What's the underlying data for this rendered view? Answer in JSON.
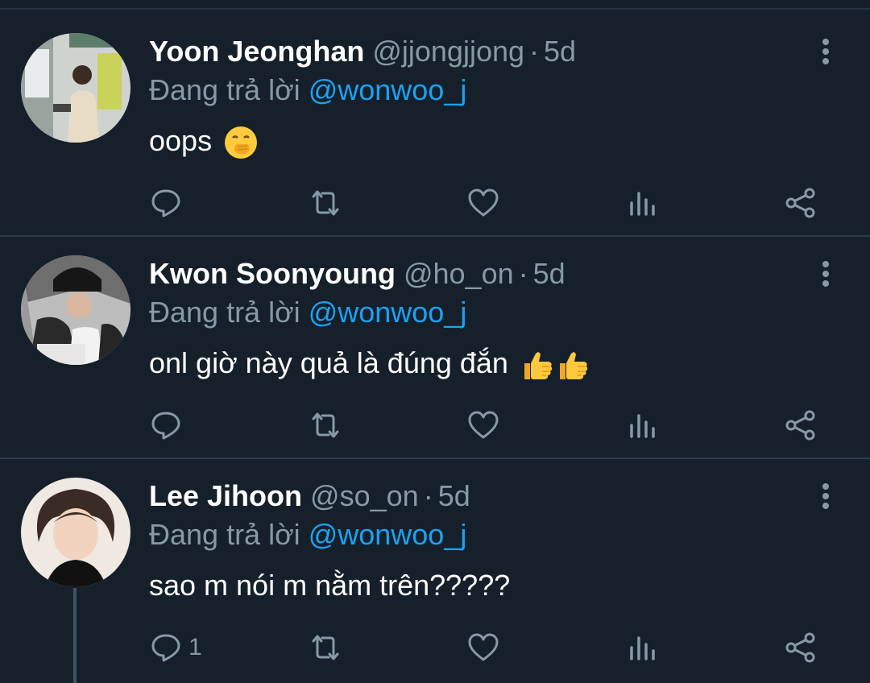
{
  "colors": {
    "background": "#15202b",
    "text": "#ffffff",
    "muted": "#8899a6",
    "accent": "#1da1f2",
    "divider": "#2f3d4b"
  },
  "tweets": [
    {
      "name": "Yoon Jeonghan",
      "handle": "@jjongjjong",
      "separator": "·",
      "time": "5d",
      "reply_prefix": "Đang trả lời",
      "reply_to": "@wonwoo_j",
      "text": "oops",
      "emoji": [
        "face-with-hand-over-mouth-emoji"
      ],
      "reply_count": ""
    },
    {
      "name": "Kwon Soonyoung",
      "handle": "@ho_on",
      "separator": "·",
      "time": "5d",
      "reply_prefix": "Đang trả lời",
      "reply_to": "@wonwoo_j",
      "text": "onl giờ này quả là đúng đắn",
      "emoji": [
        "thumbs-up-emoji",
        "thumbs-up-emoji"
      ],
      "reply_count": ""
    },
    {
      "name": "Lee Jihoon",
      "handle": "@so_on",
      "separator": "·",
      "time": "5d",
      "reply_prefix": "Đang trả lời",
      "reply_to": "@wonwoo_j",
      "text": "sao m nói m nằm trên?????",
      "emoji": [],
      "reply_count": "1"
    }
  ]
}
